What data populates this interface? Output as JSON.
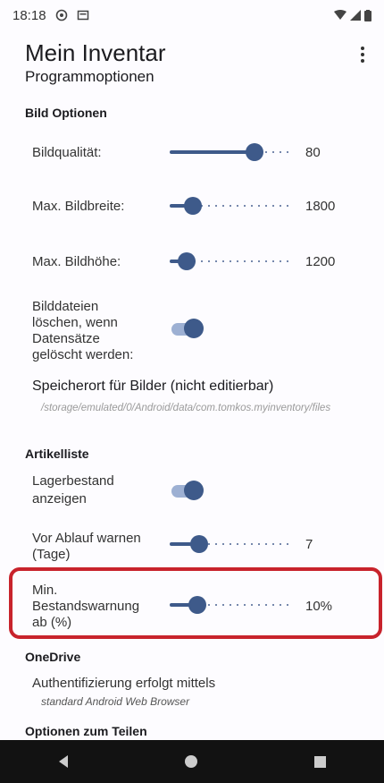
{
  "status": {
    "time": "18:18"
  },
  "app": {
    "title": "Mein Inventar",
    "subtitle": "Programmoptionen"
  },
  "sections": {
    "image_options": "Bild Optionen",
    "article_list": "Artikelliste",
    "onedrive": "OneDrive",
    "sharing": "Optionen zum Teilen"
  },
  "settings": {
    "image_quality": {
      "label": "Bildqualität:",
      "value": "80",
      "fraction": 0.74
    },
    "max_width": {
      "label": "Max. Bildbreite:",
      "value": "1800",
      "fraction": 0.14
    },
    "max_height": {
      "label": "Max. Bildhöhe:",
      "value": "1200",
      "fraction": 0.08
    },
    "delete_images": {
      "line1": "Bilddateien",
      "line2": "löschen, wenn",
      "line3": "Datensätze",
      "line4": "gelöscht werden:",
      "on": true
    },
    "storage": {
      "label": "Speicherort für Bilder (nicht editierbar)",
      "path": "/storage/emulated/0/Android/data/com.tomkos.myinventory/files"
    },
    "show_stock": {
      "line1": "Lagerbestand",
      "line2": "anzeigen",
      "on": true
    },
    "warn_before_expiry": {
      "line1": "Vor Ablauf warnen",
      "line2": "(Tage)",
      "value": "7",
      "fraction": 0.2
    },
    "min_stock_warning": {
      "line1": "Min.",
      "line2": "Bestandswarnung",
      "line3": "ab (%)",
      "value": "10%",
      "fraction": 0.18
    },
    "auth": {
      "label": "Authentifizierung erfolgt mittels",
      "value": "standard Android Web Browser"
    }
  },
  "colors": {
    "accent": "#3e5a8a",
    "highlight": "#c8232c"
  }
}
